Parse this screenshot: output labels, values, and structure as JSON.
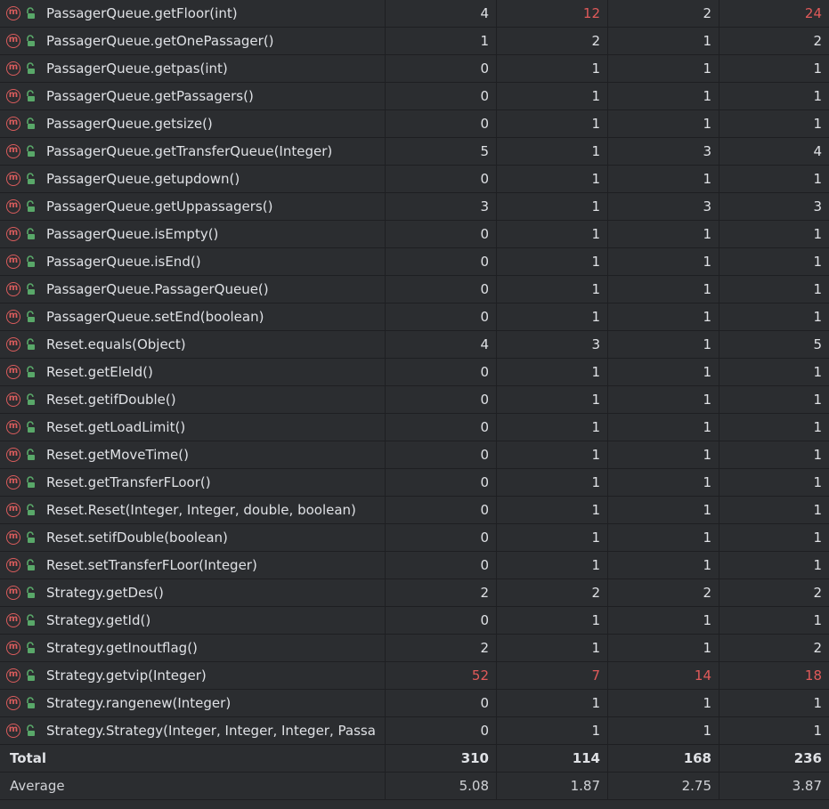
{
  "methods": [
    {
      "name": "PassagerQueue.getFloor(int)",
      "v": [
        "4",
        "12",
        "2",
        "24"
      ],
      "hi": [
        false,
        true,
        false,
        true
      ]
    },
    {
      "name": "PassagerQueue.getOnePassager()",
      "v": [
        "1",
        "2",
        "1",
        "2"
      ],
      "hi": [
        false,
        false,
        false,
        false
      ]
    },
    {
      "name": "PassagerQueue.getpas(int)",
      "v": [
        "0",
        "1",
        "1",
        "1"
      ],
      "hi": [
        false,
        false,
        false,
        false
      ]
    },
    {
      "name": "PassagerQueue.getPassagers()",
      "v": [
        "0",
        "1",
        "1",
        "1"
      ],
      "hi": [
        false,
        false,
        false,
        false
      ]
    },
    {
      "name": "PassagerQueue.getsize()",
      "v": [
        "0",
        "1",
        "1",
        "1"
      ],
      "hi": [
        false,
        false,
        false,
        false
      ]
    },
    {
      "name": "PassagerQueue.getTransferQueue(Integer)",
      "v": [
        "5",
        "1",
        "3",
        "4"
      ],
      "hi": [
        false,
        false,
        false,
        false
      ]
    },
    {
      "name": "PassagerQueue.getupdown()",
      "v": [
        "0",
        "1",
        "1",
        "1"
      ],
      "hi": [
        false,
        false,
        false,
        false
      ]
    },
    {
      "name": "PassagerQueue.getUppassagers()",
      "v": [
        "3",
        "1",
        "3",
        "3"
      ],
      "hi": [
        false,
        false,
        false,
        false
      ]
    },
    {
      "name": "PassagerQueue.isEmpty()",
      "v": [
        "0",
        "1",
        "1",
        "1"
      ],
      "hi": [
        false,
        false,
        false,
        false
      ]
    },
    {
      "name": "PassagerQueue.isEnd()",
      "v": [
        "0",
        "1",
        "1",
        "1"
      ],
      "hi": [
        false,
        false,
        false,
        false
      ]
    },
    {
      "name": "PassagerQueue.PassagerQueue()",
      "v": [
        "0",
        "1",
        "1",
        "1"
      ],
      "hi": [
        false,
        false,
        false,
        false
      ]
    },
    {
      "name": "PassagerQueue.setEnd(boolean)",
      "v": [
        "0",
        "1",
        "1",
        "1"
      ],
      "hi": [
        false,
        false,
        false,
        false
      ]
    },
    {
      "name": "Reset.equals(Object)",
      "v": [
        "4",
        "3",
        "1",
        "5"
      ],
      "hi": [
        false,
        false,
        false,
        false
      ]
    },
    {
      "name": "Reset.getEleId()",
      "v": [
        "0",
        "1",
        "1",
        "1"
      ],
      "hi": [
        false,
        false,
        false,
        false
      ]
    },
    {
      "name": "Reset.getifDouble()",
      "v": [
        "0",
        "1",
        "1",
        "1"
      ],
      "hi": [
        false,
        false,
        false,
        false
      ]
    },
    {
      "name": "Reset.getLoadLimit()",
      "v": [
        "0",
        "1",
        "1",
        "1"
      ],
      "hi": [
        false,
        false,
        false,
        false
      ]
    },
    {
      "name": "Reset.getMoveTime()",
      "v": [
        "0",
        "1",
        "1",
        "1"
      ],
      "hi": [
        false,
        false,
        false,
        false
      ]
    },
    {
      "name": "Reset.getTransferFLoor()",
      "v": [
        "0",
        "1",
        "1",
        "1"
      ],
      "hi": [
        false,
        false,
        false,
        false
      ]
    },
    {
      "name": "Reset.Reset(Integer, Integer, double, boolean)",
      "v": [
        "0",
        "1",
        "1",
        "1"
      ],
      "hi": [
        false,
        false,
        false,
        false
      ]
    },
    {
      "name": "Reset.setifDouble(boolean)",
      "v": [
        "0",
        "1",
        "1",
        "1"
      ],
      "hi": [
        false,
        false,
        false,
        false
      ]
    },
    {
      "name": "Reset.setTransferFLoor(Integer)",
      "v": [
        "0",
        "1",
        "1",
        "1"
      ],
      "hi": [
        false,
        false,
        false,
        false
      ]
    },
    {
      "name": "Strategy.getDes()",
      "v": [
        "2",
        "2",
        "2",
        "2"
      ],
      "hi": [
        false,
        false,
        false,
        false
      ]
    },
    {
      "name": "Strategy.getId()",
      "v": [
        "0",
        "1",
        "1",
        "1"
      ],
      "hi": [
        false,
        false,
        false,
        false
      ]
    },
    {
      "name": "Strategy.getInoutflag()",
      "v": [
        "2",
        "1",
        "1",
        "2"
      ],
      "hi": [
        false,
        false,
        false,
        false
      ]
    },
    {
      "name": "Strategy.getvip(Integer)",
      "v": [
        "52",
        "7",
        "14",
        "18"
      ],
      "hi": [
        true,
        true,
        true,
        true
      ]
    },
    {
      "name": "Strategy.rangenew(Integer)",
      "v": [
        "0",
        "1",
        "1",
        "1"
      ],
      "hi": [
        false,
        false,
        false,
        false
      ]
    },
    {
      "name": "Strategy.Strategy(Integer, Integer, Integer, Passa",
      "v": [
        "0",
        "1",
        "1",
        "1"
      ],
      "hi": [
        false,
        false,
        false,
        false
      ]
    }
  ],
  "total": {
    "label": "Total",
    "v": [
      "310",
      "114",
      "168",
      "236"
    ]
  },
  "average": {
    "label": "Average",
    "v": [
      "5.08",
      "1.87",
      "2.75",
      "3.87"
    ]
  },
  "icons": {
    "method": "method-m-icon",
    "access": "public-lock-icon"
  },
  "colors": {
    "highlight": "#e15a5a",
    "method_icon": "#d95c5c",
    "lock_icon": "#59a869"
  }
}
